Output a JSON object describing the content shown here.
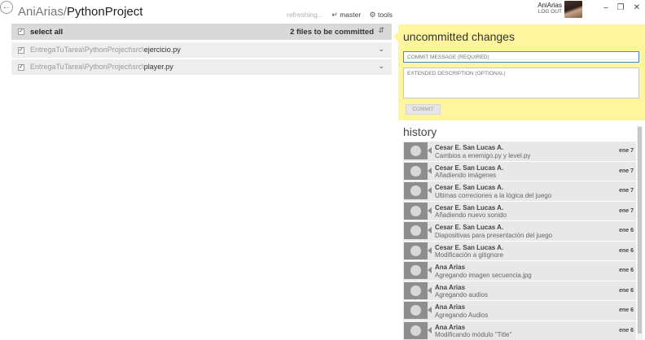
{
  "header": {
    "owner": "AniArias",
    "separator": "/",
    "repo": "PythonProject",
    "back_icon": "arrow-left-icon",
    "status": "refreshing...",
    "branch": "master",
    "tools": "tools"
  },
  "user": {
    "name": "AniArias",
    "logout": "LOG OUT"
  },
  "window": {
    "minimize": "–",
    "restore": "❐",
    "close": "✕"
  },
  "changes": {
    "select_all_label": "select all",
    "count_text": "2 files to be committed",
    "files": [
      {
        "path": "EntregaTuTarea\\PythonProject\\src\\",
        "name": "ejercicio.py",
        "checked": true
      },
      {
        "path": "EntregaTuTarea\\PythonProject\\src\\",
        "name": "player.py",
        "checked": true
      }
    ]
  },
  "commit": {
    "title": "uncommitted changes",
    "message_placeholder": "COMMIT MESSAGE (REQUIRED)",
    "description_placeholder": "EXTENDED DESCRIPTION (OPTIONAL)",
    "button": "COMMIT",
    "panel_color": "#fff59e"
  },
  "history": {
    "title": "history",
    "items": [
      {
        "author": "Cesar E. San Lucas A.",
        "message": "Cambios a enemigo.py y level.py",
        "date": "ene 7"
      },
      {
        "author": "Cesar E. San Lucas A.",
        "message": "Añadiendo imágenes",
        "date": "ene 7"
      },
      {
        "author": "Cesar E. San Lucas A.",
        "message": "Ultimas correciones a la lógica del juego",
        "date": "ene 7"
      },
      {
        "author": "Cesar E. San Lucas A.",
        "message": "Añadiendo nuevo sonido",
        "date": "ene 7"
      },
      {
        "author": "Cesar E. San Lucas A.",
        "message": "Diapositivas para presentación del juego",
        "date": "ene 6"
      },
      {
        "author": "Cesar E. San Lucas A.",
        "message": "Modificación a gitignore",
        "date": "ene 6"
      },
      {
        "author": "Ana Arias",
        "message": "Agregando imagen secuencia.jpg",
        "date": "ene 6"
      },
      {
        "author": "Ana Arias",
        "message": "Agregando audios",
        "date": "ene 6"
      },
      {
        "author": "Ana Arias",
        "message": "Agregando Audios",
        "date": "ene 6"
      },
      {
        "author": "Ana Arias",
        "message": "Modificando módulo \"Title\"",
        "date": "ene 6"
      }
    ]
  }
}
